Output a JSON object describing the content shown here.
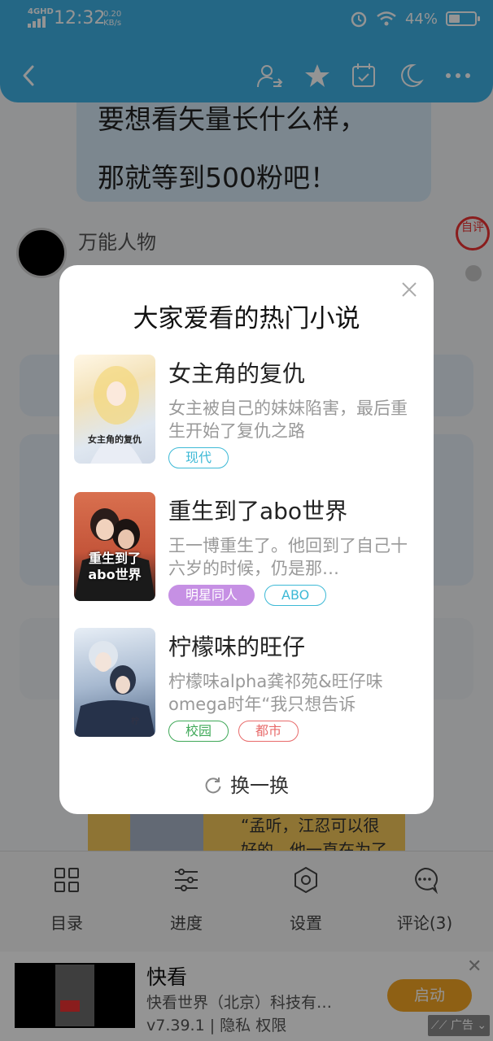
{
  "status_bar": {
    "network": "4GHD",
    "time": "12:32",
    "speed_value": "0.20",
    "speed_unit": "KB/s",
    "battery": "44%",
    "battery_level": 0.44
  },
  "reader": {
    "bubble_lines": [
      "要想看矢量长什么样，",
      "那就等到500粉吧！"
    ],
    "character_name": "万能人物",
    "stamp": "自评",
    "story_lines": [
      "“孟听，江忍可以很",
      "好的，他一直在为了"
    ]
  },
  "modal": {
    "title": "大家爱看的热门小说",
    "novels": [
      {
        "title": "女主角的复仇",
        "description": "女主被自己的妹妹陷害，最后重生开始了复仇之路",
        "cover_text": "女主角的复仇",
        "tags": [
          "现代"
        ]
      },
      {
        "title": "重生到了abo世界",
        "description": "王一博重生了。他回到了自己十六岁的时候，仍是那…",
        "cover_text": "重生到了abo世界",
        "tags": [
          "明星同人",
          "ABO"
        ]
      },
      {
        "title": "柠檬味的旺仔",
        "description": "柠檬味alpha龚祁苑&旺仔味omega时年“我只想告诉",
        "cover_text": "",
        "tags": [
          "校园",
          "都市"
        ]
      }
    ],
    "refresh_label": "换一换"
  },
  "bottom_menu": [
    {
      "label": "目录",
      "icon": "grid-icon"
    },
    {
      "label": "进度",
      "icon": "sliders-icon"
    },
    {
      "label": "设置",
      "icon": "gear-icon"
    },
    {
      "label": "评论(3)",
      "icon": "comment-icon"
    }
  ],
  "ad": {
    "title": "快看",
    "company": "快看世界（北京）科技有…",
    "meta": "v7.39.1 | 隐私  权限",
    "button": "启动",
    "label": "广告"
  },
  "colors": {
    "accent": "#3fb2e6",
    "tag_cyan": "#3db9d6",
    "tag_purple": "#c690e4",
    "tag_green": "#3fa858",
    "tag_red": "#e86b6b",
    "ad_button": "#f5a623"
  }
}
